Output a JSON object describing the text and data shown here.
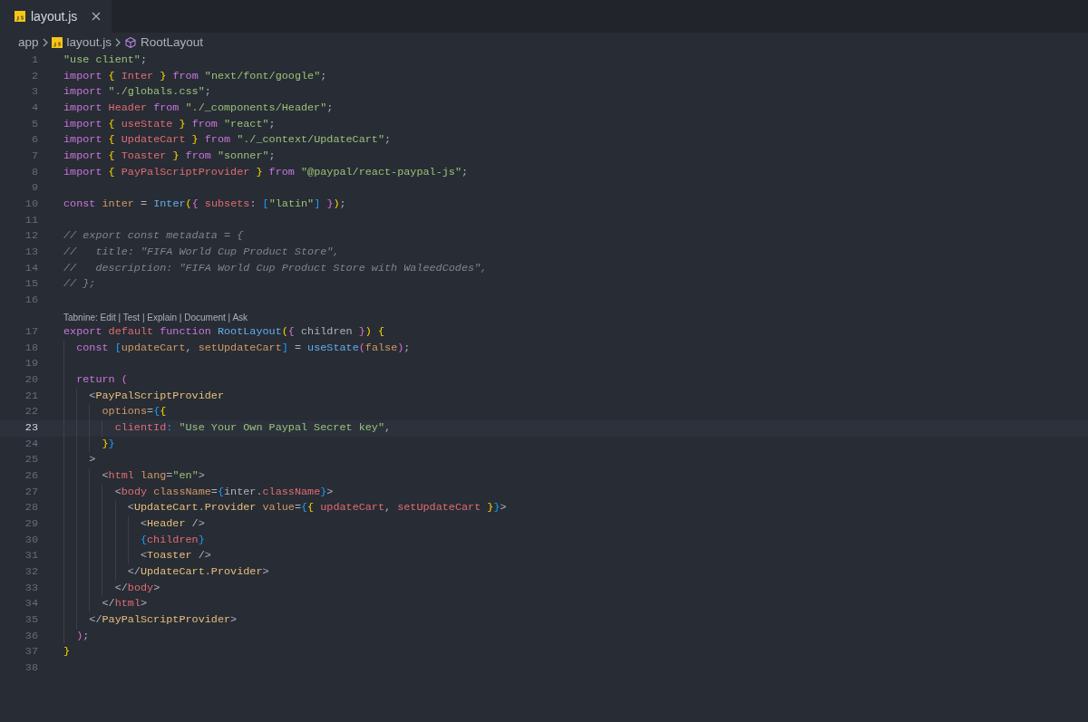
{
  "tabs": [
    {
      "label": "layout.js",
      "selected": true
    }
  ],
  "breadcrumb": [
    {
      "kind": "folder",
      "label": "app"
    },
    {
      "kind": "file",
      "label": "layout.js"
    },
    {
      "kind": "symbol",
      "label": "RootLayout"
    }
  ],
  "lines": [
    {
      "number": "1",
      "selected": false,
      "tokens": [
        {
          "kind": "str",
          "text": "\"use client\""
        },
        {
          "kind": "pl",
          "text": ";"
        }
      ]
    },
    {
      "number": "2",
      "selected": false,
      "tokens": [
        {
          "kind": "kw",
          "text": "import "
        },
        {
          "kind": "y",
          "text": "{"
        },
        {
          "kind": "var",
          "text": " Inter "
        },
        {
          "kind": "y",
          "text": "}"
        },
        {
          "kind": "kw",
          "text": " from "
        },
        {
          "kind": "str",
          "text": "\"next/font/google\""
        },
        {
          "kind": "pl",
          "text": ";"
        }
      ]
    },
    {
      "number": "3",
      "selected": false,
      "tokens": [
        {
          "kind": "kw",
          "text": "import "
        },
        {
          "kind": "str",
          "text": "\"./globals.css\""
        },
        {
          "kind": "pl",
          "text": ";"
        }
      ]
    },
    {
      "number": "4",
      "selected": false,
      "tokens": [
        {
          "kind": "kw",
          "text": "import "
        },
        {
          "kind": "var",
          "text": "Header"
        },
        {
          "kind": "kw",
          "text": " from "
        },
        {
          "kind": "str",
          "text": "\"./_components/Header\""
        },
        {
          "kind": "pl",
          "text": ";"
        }
      ]
    },
    {
      "number": "5",
      "selected": false,
      "tokens": [
        {
          "kind": "kw",
          "text": "import "
        },
        {
          "kind": "y",
          "text": "{"
        },
        {
          "kind": "var",
          "text": " useState "
        },
        {
          "kind": "y",
          "text": "}"
        },
        {
          "kind": "kw",
          "text": " from "
        },
        {
          "kind": "str",
          "text": "\"react\""
        },
        {
          "kind": "pl",
          "text": ";"
        }
      ]
    },
    {
      "number": "6",
      "selected": false,
      "tokens": [
        {
          "kind": "kw",
          "text": "import "
        },
        {
          "kind": "y",
          "text": "{"
        },
        {
          "kind": "var",
          "text": " UpdateCart "
        },
        {
          "kind": "y",
          "text": "}"
        },
        {
          "kind": "kw",
          "text": " from "
        },
        {
          "kind": "str",
          "text": "\"./_context/UpdateCart\""
        },
        {
          "kind": "pl",
          "text": ";"
        }
      ]
    },
    {
      "number": "7",
      "selected": false,
      "tokens": [
        {
          "kind": "kw",
          "text": "import "
        },
        {
          "kind": "y",
          "text": "{"
        },
        {
          "kind": "var",
          "text": " Toaster "
        },
        {
          "kind": "y",
          "text": "}"
        },
        {
          "kind": "kw",
          "text": " from "
        },
        {
          "kind": "str",
          "text": "\"sonner\""
        },
        {
          "kind": "pl",
          "text": ";"
        }
      ]
    },
    {
      "number": "8",
      "selected": false,
      "tokens": [
        {
          "kind": "kw",
          "text": "import "
        },
        {
          "kind": "y",
          "text": "{"
        },
        {
          "kind": "var",
          "text": " PayPalScriptProvider "
        },
        {
          "kind": "y",
          "text": "}"
        },
        {
          "kind": "kw",
          "text": " from "
        },
        {
          "kind": "str",
          "text": "\"@paypal/react-paypal-js\""
        },
        {
          "kind": "pl",
          "text": ";"
        }
      ]
    },
    {
      "number": "9",
      "selected": false
    },
    {
      "number": "10",
      "selected": false,
      "tokens": [
        {
          "kind": "kw",
          "text": "const "
        },
        {
          "kind": "or",
          "text": "inter"
        },
        {
          "kind": "pl",
          "text": " = "
        },
        {
          "kind": "fn",
          "text": "Inter"
        },
        {
          "kind": "y",
          "text": "("
        },
        {
          "kind": "p",
          "text": "{"
        },
        {
          "kind": "var",
          "text": " subsets"
        },
        {
          "kind": "pl",
          "text": ": "
        },
        {
          "kind": "b",
          "text": "["
        },
        {
          "kind": "str",
          "text": "\"latin\""
        },
        {
          "kind": "b",
          "text": "]"
        },
        {
          "kind": "p",
          "text": " }"
        },
        {
          "kind": "y",
          "text": ")"
        },
        {
          "kind": "pl",
          "text": ";"
        }
      ]
    },
    {
      "number": "11",
      "selected": false
    },
    {
      "number": "12",
      "selected": false,
      "tokens": [
        {
          "kind": "cm",
          "text": "// export const metadata = {"
        }
      ]
    },
    {
      "number": "13",
      "selected": false,
      "tokens": [
        {
          "kind": "cm",
          "text": "//   title: \"FIFA World Cup Product Store\","
        }
      ]
    },
    {
      "number": "14",
      "selected": false,
      "tokens": [
        {
          "kind": "cm",
          "text": "//   description: \"FIFA World Cup Product Store with WaleedCodes\","
        }
      ]
    },
    {
      "number": "15",
      "selected": false,
      "tokens": [
        {
          "kind": "cm",
          "text": "// };"
        }
      ]
    },
    {
      "number": "16",
      "selected": false
    },
    {
      "number": "17",
      "selected": false,
      "lens": "Tabnine: Edit | Test | Explain | Document | Ask",
      "tokens": [
        {
          "kind": "kw",
          "text": "export "
        },
        {
          "kind": "var",
          "text": "default "
        },
        {
          "kind": "kw",
          "text": "function "
        },
        {
          "kind": "fn",
          "text": "RootLayout"
        },
        {
          "kind": "y",
          "text": "("
        },
        {
          "kind": "p",
          "text": "{"
        },
        {
          "kind": "pl",
          "text": " children "
        },
        {
          "kind": "p",
          "text": "}"
        },
        {
          "kind": "y",
          "text": ")"
        },
        {
          "kind": "y",
          "text": " {"
        }
      ]
    },
    {
      "number": "18",
      "selected": false,
      "tokens": [
        {
          "kind": "kw",
          "text": "  const "
        },
        {
          "kind": "b",
          "text": "["
        },
        {
          "kind": "or",
          "text": "updateCart"
        },
        {
          "kind": "pl",
          "text": ", "
        },
        {
          "kind": "or",
          "text": "setUpdateCart"
        },
        {
          "kind": "b",
          "text": "]"
        },
        {
          "kind": "pl",
          "text": " = "
        },
        {
          "kind": "fn",
          "text": "useState"
        },
        {
          "kind": "p",
          "text": "("
        },
        {
          "kind": "or",
          "text": "false"
        },
        {
          "kind": "p",
          "text": ")"
        },
        {
          "kind": "pl",
          "text": ";"
        }
      ]
    },
    {
      "number": "19",
      "selected": false
    },
    {
      "number": "20",
      "selected": false,
      "tokens": [
        {
          "kind": "kw",
          "text": "  return "
        },
        {
          "kind": "p",
          "text": "("
        }
      ]
    },
    {
      "number": "21",
      "selected": false,
      "tokens": [
        {
          "kind": "pl",
          "text": "    <"
        },
        {
          "kind": "tag",
          "text": "PayPalScriptProvider"
        }
      ]
    },
    {
      "number": "22",
      "selected": false,
      "tokens": [
        {
          "kind": "attr",
          "text": "      options"
        },
        {
          "kind": "pl",
          "text": "="
        },
        {
          "kind": "b",
          "text": "{"
        },
        {
          "kind": "y",
          "text": "{"
        }
      ]
    },
    {
      "number": "23",
      "selected": true,
      "tokens": [
        {
          "kind": "var",
          "text": "        clientId"
        },
        {
          "kind": "b",
          "text": ":"
        },
        {
          "kind": "str",
          "text": " \"Use Your Own Paypal Secret key\""
        },
        {
          "kind": "pl",
          "text": ","
        }
      ]
    },
    {
      "number": "24",
      "selected": false,
      "tokens": [
        {
          "kind": "y",
          "text": "      }"
        },
        {
          "kind": "b",
          "text": "}"
        }
      ]
    },
    {
      "number": "25",
      "selected": false,
      "tokens": [
        {
          "kind": "pl",
          "text": "    >"
        }
      ]
    },
    {
      "number": "26",
      "selected": false,
      "tokens": [
        {
          "kind": "pl",
          "text": "      <"
        },
        {
          "kind": "var",
          "text": "html"
        },
        {
          "kind": "attr",
          "text": " lang"
        },
        {
          "kind": "pl",
          "text": "="
        },
        {
          "kind": "str",
          "text": "\"en\""
        },
        {
          "kind": "pl",
          "text": ">"
        }
      ]
    },
    {
      "number": "27",
      "selected": false,
      "tokens": [
        {
          "kind": "pl",
          "text": "        <"
        },
        {
          "kind": "var",
          "text": "body"
        },
        {
          "kind": "attr",
          "text": " className"
        },
        {
          "kind": "pl",
          "text": "="
        },
        {
          "kind": "b",
          "text": "{"
        },
        {
          "kind": "pl",
          "text": "inter."
        },
        {
          "kind": "var",
          "text": "className"
        },
        {
          "kind": "b",
          "text": "}"
        },
        {
          "kind": "pl",
          "text": ">"
        }
      ]
    },
    {
      "number": "28",
      "selected": false,
      "tokens": [
        {
          "kind": "pl",
          "text": "          <"
        },
        {
          "kind": "tag",
          "text": "UpdateCart.Provider"
        },
        {
          "kind": "attr",
          "text": " value"
        },
        {
          "kind": "pl",
          "text": "="
        },
        {
          "kind": "b",
          "text": "{"
        },
        {
          "kind": "y",
          "text": "{"
        },
        {
          "kind": "var",
          "text": " updateCart"
        },
        {
          "kind": "pl",
          "text": ", "
        },
        {
          "kind": "var",
          "text": "setUpdateCart "
        },
        {
          "kind": "y",
          "text": "}"
        },
        {
          "kind": "b",
          "text": "}"
        },
        {
          "kind": "pl",
          "text": ">"
        }
      ]
    },
    {
      "number": "29",
      "selected": false,
      "tokens": [
        {
          "kind": "pl",
          "text": "            <"
        },
        {
          "kind": "tag",
          "text": "Header"
        },
        {
          "kind": "pl",
          "text": " />"
        }
      ]
    },
    {
      "number": "30",
      "selected": false,
      "tokens": [
        {
          "kind": "b",
          "text": "            {"
        },
        {
          "kind": "var",
          "text": "children"
        },
        {
          "kind": "b",
          "text": "}"
        }
      ]
    },
    {
      "number": "31",
      "selected": false,
      "tokens": [
        {
          "kind": "pl",
          "text": "            <"
        },
        {
          "kind": "tag",
          "text": "Toaster"
        },
        {
          "kind": "pl",
          "text": " />"
        }
      ]
    },
    {
      "number": "32",
      "selected": false,
      "tokens": [
        {
          "kind": "pl",
          "text": "          </"
        },
        {
          "kind": "tag",
          "text": "UpdateCart.Provider"
        },
        {
          "kind": "pl",
          "text": ">"
        }
      ]
    },
    {
      "number": "33",
      "selected": false,
      "tokens": [
        {
          "kind": "pl",
          "text": "        </"
        },
        {
          "kind": "var",
          "text": "body"
        },
        {
          "kind": "pl",
          "text": ">"
        }
      ]
    },
    {
      "number": "34",
      "selected": false,
      "tokens": [
        {
          "kind": "pl",
          "text": "      </"
        },
        {
          "kind": "var",
          "text": "html"
        },
        {
          "kind": "pl",
          "text": ">"
        }
      ]
    },
    {
      "number": "35",
      "selected": false,
      "tokens": [
        {
          "kind": "pl",
          "text": "    </"
        },
        {
          "kind": "tag",
          "text": "PayPalScriptProvider"
        },
        {
          "kind": "pl",
          "text": ">"
        }
      ]
    },
    {
      "number": "36",
      "selected": false,
      "tokens": [
        {
          "kind": "p",
          "text": "  )"
        },
        {
          "kind": "pl",
          "text": ";"
        }
      ]
    },
    {
      "number": "37",
      "selected": false,
      "tokens": [
        {
          "kind": "y",
          "text": "}"
        }
      ]
    },
    {
      "number": "38",
      "selected": false
    }
  ]
}
